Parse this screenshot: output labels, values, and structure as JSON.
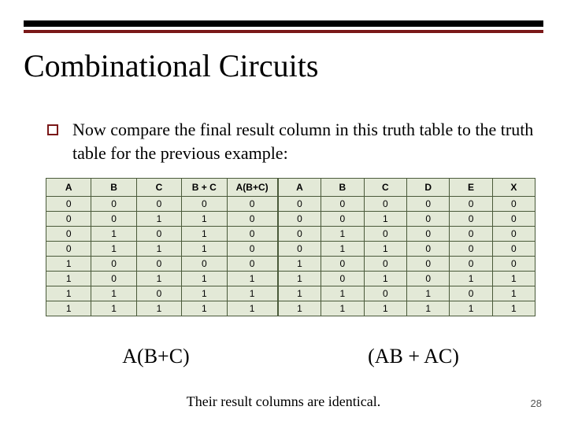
{
  "title": "Combinational Circuits",
  "bullet": "Now compare the final result column in this truth table to the truth table for the previous example:",
  "tableLeft": {
    "headers": [
      "A",
      "B",
      "C",
      "B + C",
      "A(B+C)"
    ],
    "rows": [
      [
        "0",
        "0",
        "0",
        "0",
        "0"
      ],
      [
        "0",
        "0",
        "1",
        "1",
        "0"
      ],
      [
        "0",
        "1",
        "0",
        "1",
        "0"
      ],
      [
        "0",
        "1",
        "1",
        "1",
        "0"
      ],
      [
        "1",
        "0",
        "0",
        "0",
        "0"
      ],
      [
        "1",
        "0",
        "1",
        "1",
        "1"
      ],
      [
        "1",
        "1",
        "0",
        "1",
        "1"
      ],
      [
        "1",
        "1",
        "1",
        "1",
        "1"
      ]
    ],
    "caption": "A(B+C)"
  },
  "tableRight": {
    "headers": [
      "A",
      "B",
      "C",
      "D",
      "E",
      "X"
    ],
    "rows": [
      [
        "0",
        "0",
        "0",
        "0",
        "0",
        "0"
      ],
      [
        "0",
        "0",
        "1",
        "0",
        "0",
        "0"
      ],
      [
        "0",
        "1",
        "0",
        "0",
        "0",
        "0"
      ],
      [
        "0",
        "1",
        "1",
        "0",
        "0",
        "0"
      ],
      [
        "1",
        "0",
        "0",
        "0",
        "0",
        "0"
      ],
      [
        "1",
        "0",
        "1",
        "0",
        "1",
        "1"
      ],
      [
        "1",
        "1",
        "0",
        "1",
        "0",
        "1"
      ],
      [
        "1",
        "1",
        "1",
        "1",
        "1",
        "1"
      ]
    ],
    "caption": "(AB + AC)"
  },
  "footer": "Their result columns are identical.",
  "pageNumber": "28"
}
